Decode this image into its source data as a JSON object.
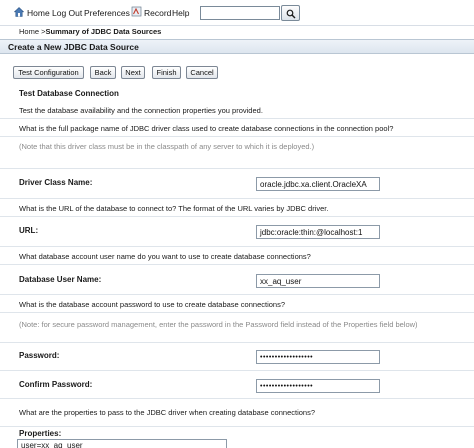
{
  "topbar": {
    "home": "Home",
    "logout": "Log Out",
    "preferences": "Preferences",
    "record": "Record",
    "help": "Help",
    "search_value": ""
  },
  "breadcrumb": {
    "home": "Home",
    "separator": " >",
    "current": "Summary of JDBC Data Sources"
  },
  "panel": {
    "title": "Create a New JDBC Data Source"
  },
  "buttons": {
    "test_configuration": "Test Configuration",
    "back": "Back",
    "next": "Next",
    "finish": "Finish",
    "cancel": "Cancel"
  },
  "section": {
    "title": "Test Database Connection",
    "description": "Test the database availability and the connection properties you provided."
  },
  "driver": {
    "question": "What is the full package name of JDBC driver class used to create database connections in the connection pool?",
    "note": "(Note that this driver class must be in the classpath of any server to which it is deployed.)",
    "label": "Driver Class Name:",
    "value": "oracle.jdbc.xa.client.OracleXA"
  },
  "url": {
    "question": "What is the URL of the database to connect to? The format of the URL varies by JDBC driver.",
    "label": "URL:",
    "value": "jdbc:oracle:thin:@localhost:1"
  },
  "user": {
    "question": "What database account user name do you want to use to create database connections?",
    "label": "Database User Name:",
    "value": "xx_aq_user"
  },
  "password": {
    "question": "What is the database account password to use to create database connections?",
    "note": "(Note: for secure password management, enter the password in the Password field instead of the Properties field below)",
    "label": "Password:",
    "value": "••••••••••••••••••",
    "confirm_label": "Confirm Password:",
    "confirm_value": "••••••••••••••••••"
  },
  "properties": {
    "question": "What are the properties to pass to the JDBC driver when creating database connections?",
    "label": "Properties:",
    "value": "user=xx_aq_user"
  }
}
